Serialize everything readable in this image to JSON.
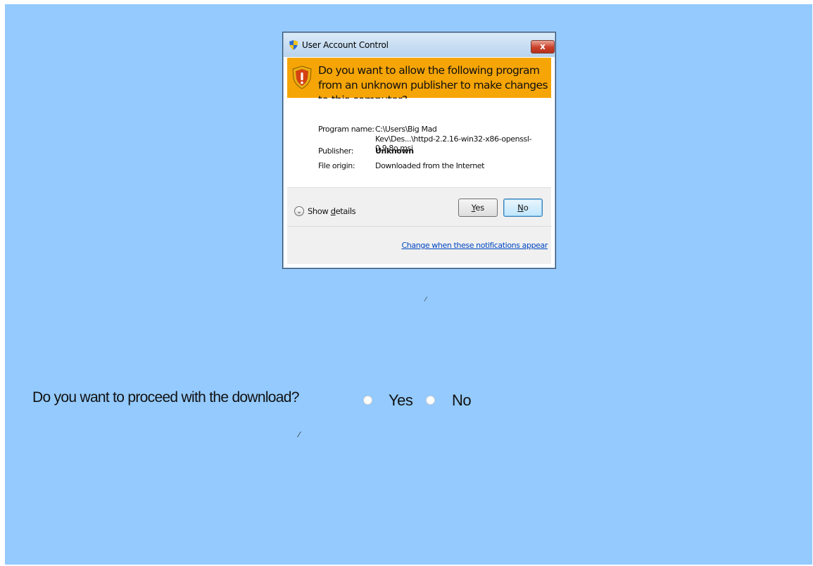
{
  "dialog": {
    "title": "User Account Control",
    "close_label": "x",
    "question": "Do you want to allow the following program from an unknown publisher to make changes to this computer?",
    "program_name_label": "Program name:",
    "program_name_line1": "C:\\Users\\Big Mad",
    "program_name_line2": "Kev\\Des...\\httpd-2.2.16-win32-x86-openssl-0.9.8o.msi",
    "publisher_label": "Publisher:",
    "publisher_value": "Unknown",
    "file_origin_label": "File origin:",
    "file_origin_value": "Downloaded from the Internet",
    "show_details_prefix": "Show ",
    "show_details_mnemonic": "d",
    "show_details_suffix": "etails",
    "yes_mnemonic": "Y",
    "yes_rest": "es",
    "no_mnemonic": "N",
    "no_rest": "o",
    "change_link": "Change when these notifications appear"
  },
  "prompt": {
    "question": "Do you want to proceed with the download?",
    "options": [
      "Yes",
      "No"
    ]
  },
  "colors": {
    "background": "#94cafe",
    "banner": "#f6a507",
    "link": "#0046c2"
  }
}
